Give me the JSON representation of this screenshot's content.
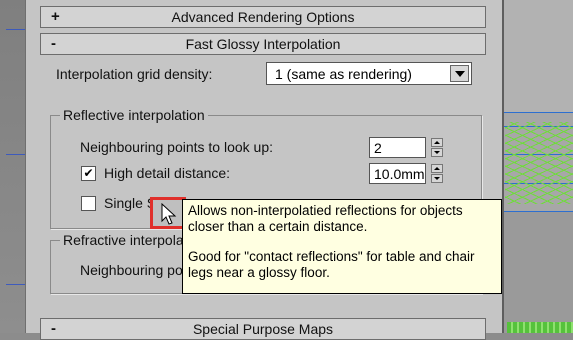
{
  "rollouts": {
    "advanced_rendering": {
      "sign": "+",
      "title": "Advanced Rendering Options"
    },
    "fast_glossy": {
      "sign": "-",
      "title": "Fast Glossy Interpolation"
    },
    "special_purpose": {
      "sign": "-",
      "title": "Special Purpose Maps"
    }
  },
  "grid_density": {
    "label": "Interpolation grid density:",
    "value": "1 (same as rendering)"
  },
  "reflective": {
    "title": "Reflective interpolation",
    "neighbouring_label": "Neighbouring points to look up:",
    "neighbouring_value": "2",
    "high_detail_checked": true,
    "high_detail_label": "High detail distance:",
    "high_detail_value": "10.0mm",
    "single_sample_label": "Single Samp"
  },
  "refractive": {
    "title": "Refractive interpola",
    "neighbouring_label": "Neighbouring po"
  },
  "tooltip": {
    "line1": "Allows non-interpolatied reflections for objects",
    "line2": "closer than a certain distance.",
    "line3": "Good for \"contact reflections\" for table and chair",
    "line4": "legs near a glossy floor."
  },
  "colors": {
    "highlight": "#e0302b",
    "tooltip_bg": "#ffffe1",
    "panel_bg": "#c5c5c5"
  },
  "icons": {
    "cursor": "help-cursor-icon"
  }
}
